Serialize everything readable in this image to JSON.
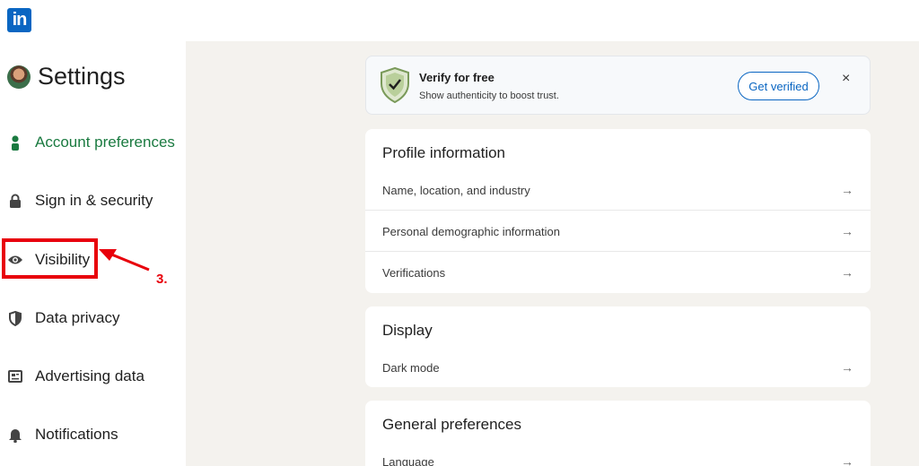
{
  "app": {
    "logo_text": "in"
  },
  "sidebar": {
    "title": "Settings",
    "items": [
      {
        "label": "Account preferences",
        "icon": "person-icon",
        "active": true
      },
      {
        "label": "Sign in & security",
        "icon": "lock-icon"
      },
      {
        "label": "Visibility",
        "icon": "eye-icon"
      },
      {
        "label": "Data privacy",
        "icon": "shield-icon"
      },
      {
        "label": "Advertising data",
        "icon": "newspaper-icon"
      },
      {
        "label": "Notifications",
        "icon": "bell-icon"
      }
    ]
  },
  "annotation": {
    "step_label": "3.",
    "color": "#e8000b"
  },
  "verify_banner": {
    "title": "Verify for free",
    "subtitle": "Show authenticity to boost trust.",
    "button_label": "Get verified",
    "close_label": "×"
  },
  "sections": {
    "profile": {
      "title": "Profile information",
      "rows": [
        "Name, location, and industry",
        "Personal demographic information",
        "Verifications"
      ]
    },
    "display": {
      "title": "Display",
      "rows": [
        "Dark mode"
      ]
    },
    "general": {
      "title": "General preferences",
      "rows": [
        "Language"
      ]
    }
  },
  "row_arrow": "→",
  "colors": {
    "brand": "#0a66c2",
    "active": "#1a7a40",
    "annotation": "#e8000b",
    "main_bg": "#f4f2ee"
  }
}
